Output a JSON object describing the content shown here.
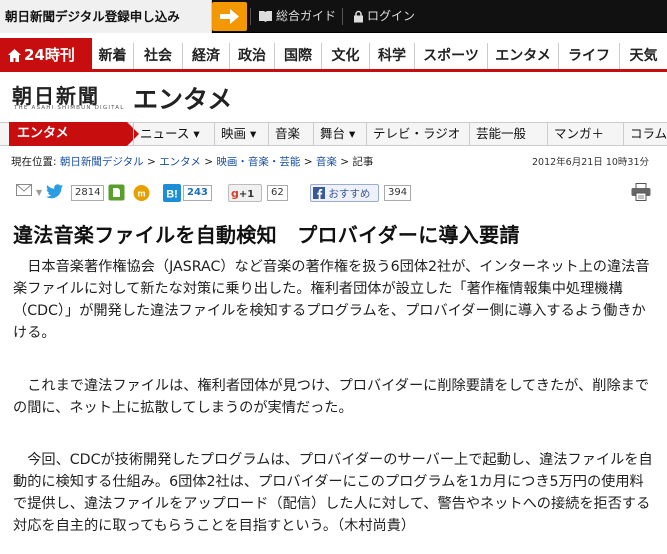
{
  "topbar": {
    "signup_label": "朝日新聞デジタル登録申し込み",
    "guide_label": "総合ガイド",
    "login_label": "ログイン"
  },
  "nav": {
    "edition_label": "24時刊",
    "categories": [
      "新着",
      "社会",
      "経済",
      "政治",
      "国際",
      "文化",
      "科学",
      "スポーツ",
      "エンタメ",
      "ライフ",
      "天気"
    ]
  },
  "header": {
    "logo_text": "朝日新聞",
    "logo_sub": "THE ASAHI SHIMBUN DIGITAL",
    "section_title": "エンタメ"
  },
  "section_nav": {
    "current": "エンタメ",
    "items": [
      "ニュース",
      "映画",
      "音楽",
      "舞台",
      "テレビ・ラジオ",
      "芸能一般",
      "マンガ＋",
      "コラム"
    ]
  },
  "breadcrumb": {
    "prefix": "現在位置:",
    "links": [
      "朝日新聞デジタル",
      "エンタメ",
      "映画・音楽・芸能",
      "音楽"
    ],
    "current": "記事",
    "separator": ">"
  },
  "timestamp": "2012年6月21日 10時31分",
  "shares": {
    "twitter_count": "2814",
    "hatena_count": "243",
    "gplus_label": "+1",
    "gplus_count": "62",
    "fb_label": "おすすめ",
    "fb_count": "394"
  },
  "article": {
    "headline": "違法音楽ファイルを自動検知　プロバイダーに導入要請",
    "paragraphs": [
      "　日本音楽著作権協会（JASRAC）など音楽の著作権を扱う6団体2社が、インターネット上の違法音楽ファイルに対して新たな対策に乗り出した。権利者団体が設立した「著作権情報集中処理機構（CDC）」が開発した違法ファイルを検知するプログラムを、プロバイダー側に導入するよう働きかける。",
      "　これまで違法ファイルは、権利者団体が見つけ、プロバイダーに削除要請をしてきたが、削除までの間に、ネット上に拡散してしまうのが実情だった。",
      "　今回、CDCが技術開発したプログラムは、プロバイダーのサーバー上で起動し、違法ファイルを自動的に検知する仕組み。6団体2社は、プロバイダーにこのプログラムを1カ月につき5万円の使用料で提供し、違法ファイルをアップロード（配信）した人に対して、警告やネットへの接続を拒否する対応を自主的に取ってもらうことを目指すという。（木村尚貴）"
    ]
  },
  "colors": {
    "brand_red": "#c70d0d",
    "accent_orange": "#f39800",
    "link_blue": "#1a4fa0"
  }
}
